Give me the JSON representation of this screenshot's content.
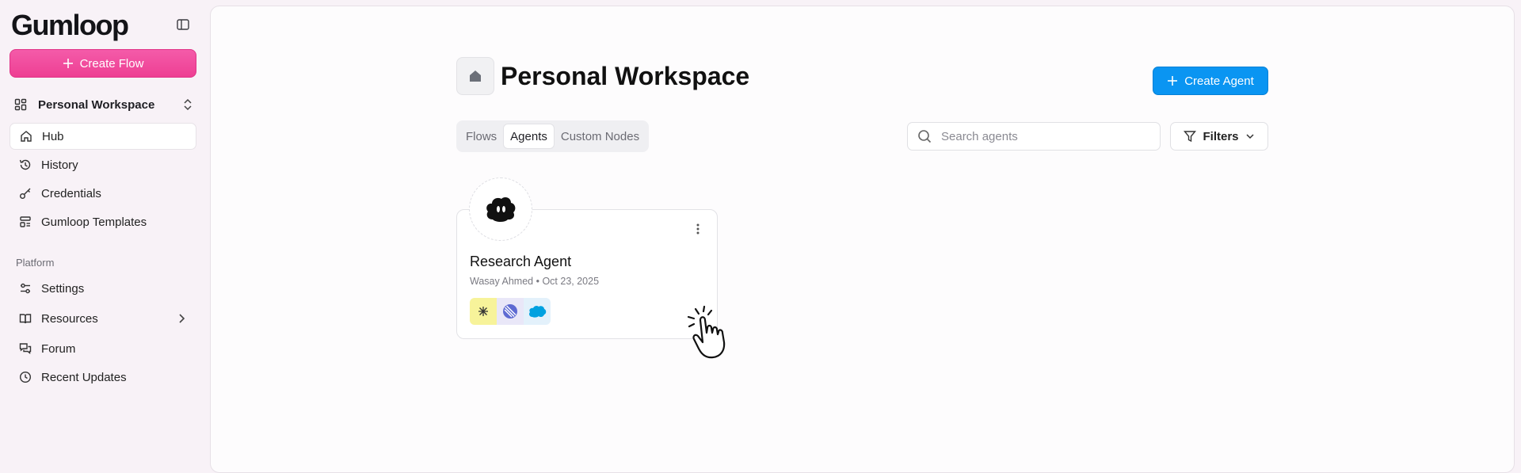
{
  "app": {
    "logo_text": "Gumloop"
  },
  "sidebar": {
    "create_flow_label": "Create Flow",
    "workspace_name": "Personal Workspace",
    "items": [
      {
        "label": "Hub",
        "icon": "home-icon",
        "active": true
      },
      {
        "label": "History",
        "icon": "history-icon"
      },
      {
        "label": "Credentials",
        "icon": "key-icon"
      },
      {
        "label": "Gumloop Templates",
        "icon": "templates-icon"
      }
    ],
    "platform_label": "Platform",
    "platform_items": [
      {
        "label": "Settings",
        "icon": "settings-sliders-icon"
      },
      {
        "label": "Resources",
        "icon": "book-icon",
        "has_arrow": true
      },
      {
        "label": "Forum",
        "icon": "chat-icon"
      },
      {
        "label": "Recent Updates",
        "icon": "clock-icon"
      }
    ]
  },
  "main": {
    "title": "Personal Workspace",
    "create_agent_label": "Create Agent",
    "tabs": [
      {
        "label": "Flows",
        "active": false
      },
      {
        "label": "Agents",
        "active": true
      },
      {
        "label": "Custom Nodes",
        "active": false
      }
    ],
    "search_placeholder": "Search agents",
    "filters_label": "Filters",
    "agents": [
      {
        "name": "Research Agent",
        "meta": "Wasay Ahmed • Oct 23, 2025",
        "tools": [
          {
            "icon": "perplexity-icon",
            "bg": "#f7f39a"
          },
          {
            "icon": "linear-icon",
            "bg": "#e9e7f8"
          },
          {
            "icon": "salesforce-icon",
            "bg": "#e3f1fb"
          }
        ]
      }
    ]
  },
  "colors": {
    "accent_pink": "#ee3f93",
    "accent_blue": "#0a95f2"
  }
}
